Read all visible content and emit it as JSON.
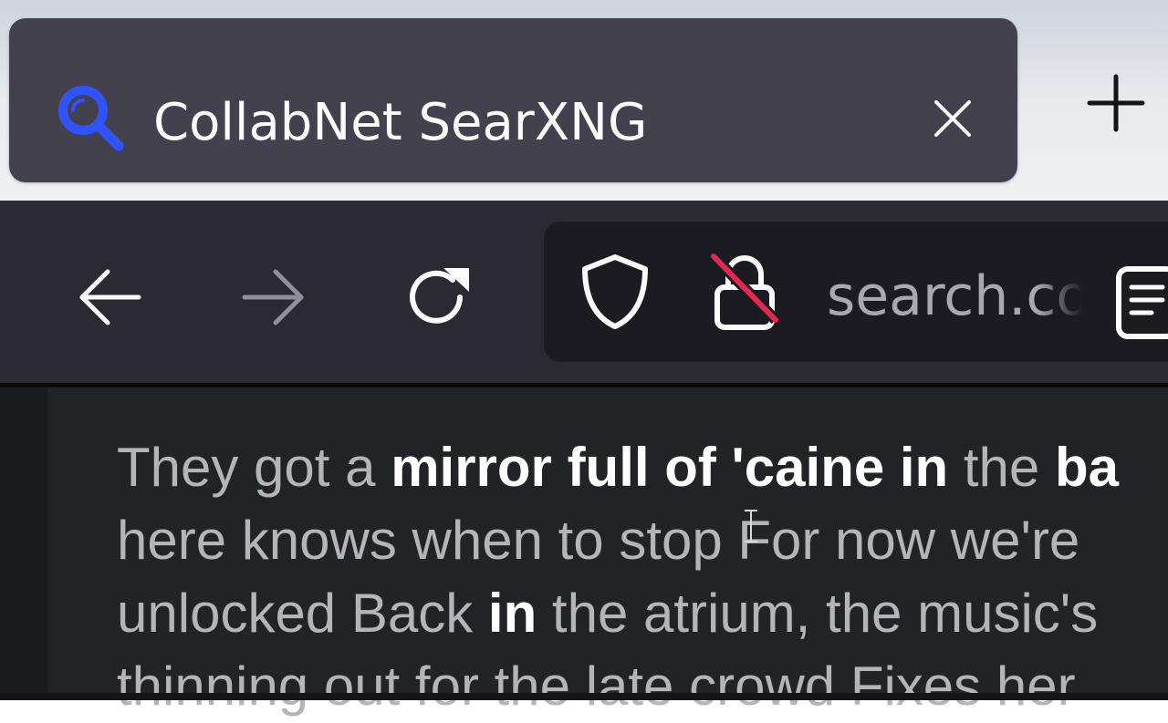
{
  "tab": {
    "title": "CollabNet SearXNG",
    "favicon": "search-magnifier-icon",
    "favicon_color": "#2f53ff",
    "close_icon": "close-icon"
  },
  "newtab_icon": "plus-icon",
  "toolbar": {
    "back_icon": "arrow-left-icon",
    "forward_icon": "arrow-right-icon",
    "reload_icon": "reload-icon",
    "forward_enabled": false
  },
  "urlbar": {
    "url_text": "search.co",
    "shield_icon": "shield-icon",
    "lock_icon": "insecure-lock-icon",
    "lock_strike_color": "#e22850",
    "reader_icon": "reader-view-icon"
  },
  "content": {
    "l1_a": "They got a ",
    "l1_b": "mirror full of 'caine in",
    "l1_c": " the ",
    "l1_d": "ba",
    "l2": "here knows when to stop For now we're",
    "l3_a": "unlocked Back ",
    "l3_b": "in",
    "l3_c": " the atrium, the music's",
    "l4": "thinning out for the late crowd Fixes her"
  }
}
